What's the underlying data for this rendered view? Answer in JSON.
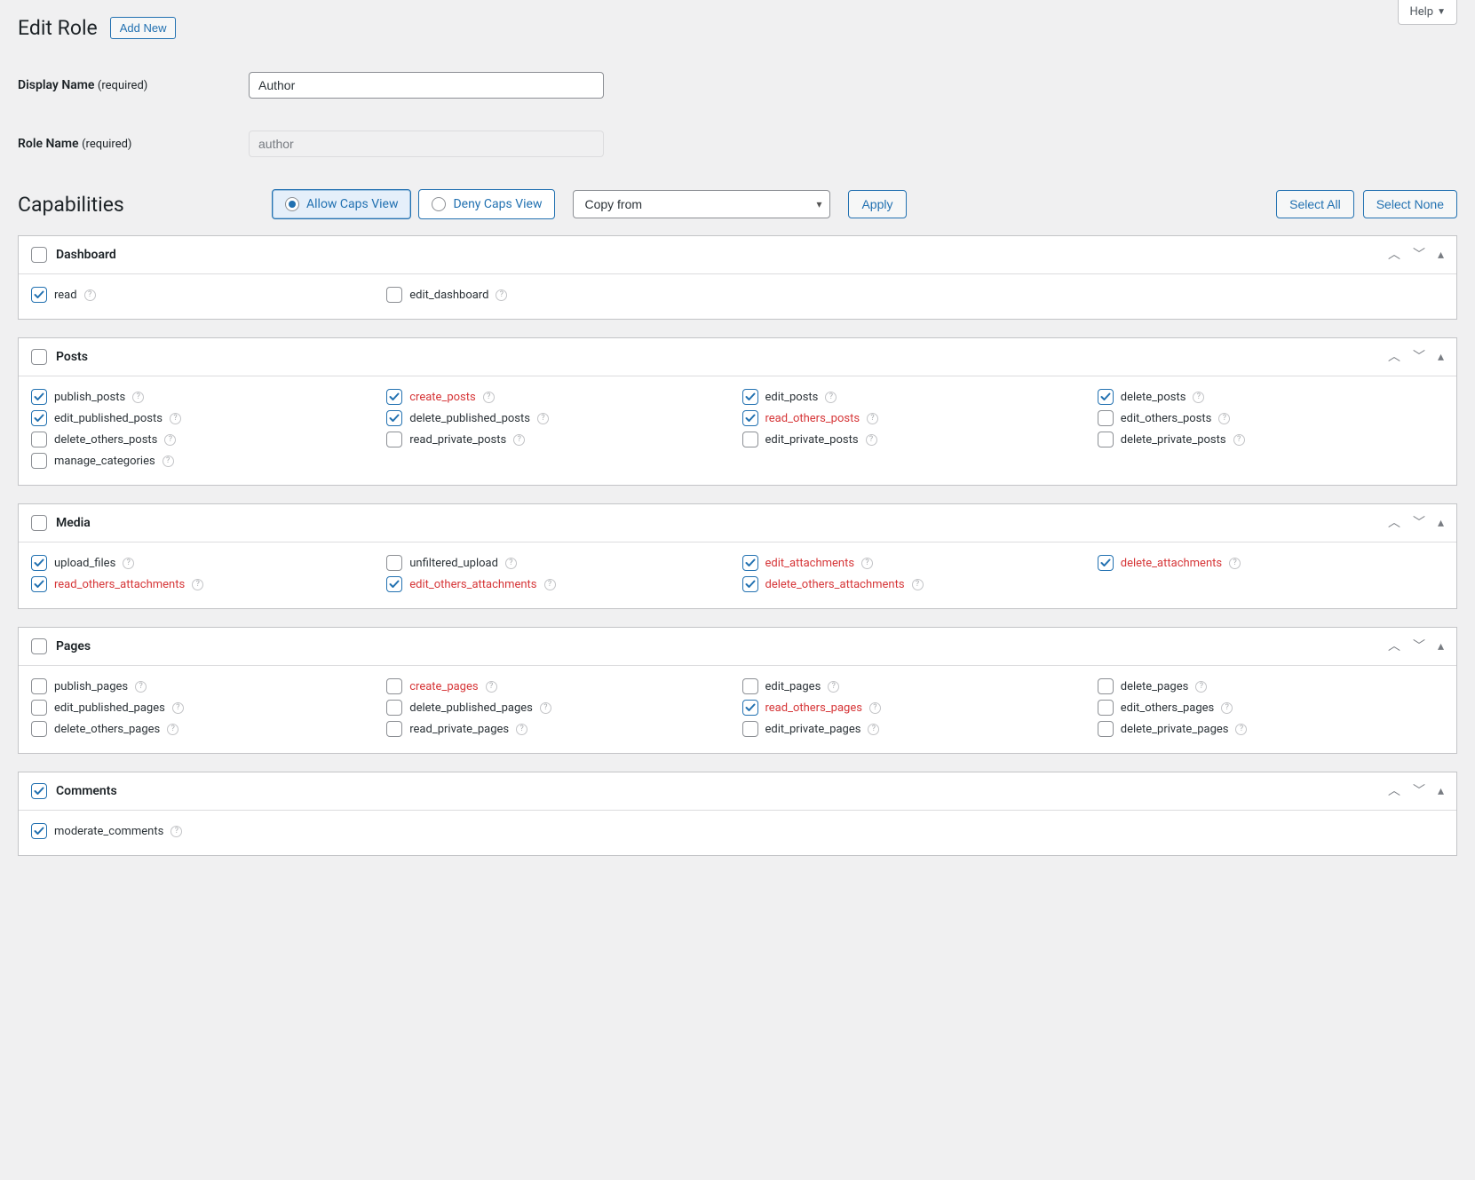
{
  "help_label": "Help",
  "page_title": "Edit Role",
  "add_new_label": "Add New",
  "display_name_label": "Display Name",
  "role_name_label": "Role Name",
  "required_label": "(required)",
  "display_name_value": "Author",
  "role_name_value": "author",
  "capabilities_title": "Capabilities",
  "allow_view_label": "Allow Caps View",
  "deny_view_label": "Deny Caps View",
  "copy_from_label": "Copy from",
  "apply_label": "Apply",
  "select_all_label": "Select All",
  "select_none_label": "Select None",
  "panels": [
    {
      "title": "Dashboard",
      "section_checked": false,
      "caps": [
        {
          "label": "read",
          "checked": true,
          "red": false
        },
        {
          "label": "edit_dashboard",
          "checked": false,
          "red": false
        }
      ]
    },
    {
      "title": "Posts",
      "section_checked": false,
      "caps": [
        {
          "label": "publish_posts",
          "checked": true,
          "red": false
        },
        {
          "label": "create_posts",
          "checked": true,
          "red": true
        },
        {
          "label": "edit_posts",
          "checked": true,
          "red": false
        },
        {
          "label": "delete_posts",
          "checked": true,
          "red": false
        },
        {
          "label": "edit_published_posts",
          "checked": true,
          "red": false
        },
        {
          "label": "delete_published_posts",
          "checked": true,
          "red": false
        },
        {
          "label": "read_others_posts",
          "checked": true,
          "red": true
        },
        {
          "label": "edit_others_posts",
          "checked": false,
          "red": false
        },
        {
          "label": "delete_others_posts",
          "checked": false,
          "red": false
        },
        {
          "label": "read_private_posts",
          "checked": false,
          "red": false
        },
        {
          "label": "edit_private_posts",
          "checked": false,
          "red": false
        },
        {
          "label": "delete_private_posts",
          "checked": false,
          "red": false
        },
        {
          "label": "manage_categories",
          "checked": false,
          "red": false
        }
      ]
    },
    {
      "title": "Media",
      "section_checked": false,
      "caps": [
        {
          "label": "upload_files",
          "checked": true,
          "red": false
        },
        {
          "label": "unfiltered_upload",
          "checked": false,
          "red": false
        },
        {
          "label": "edit_attachments",
          "checked": true,
          "red": true
        },
        {
          "label": "delete_attachments",
          "checked": true,
          "red": true
        },
        {
          "label": "read_others_attachments",
          "checked": true,
          "red": true
        },
        {
          "label": "edit_others_attachments",
          "checked": true,
          "red": true
        },
        {
          "label": "delete_others_attachments",
          "checked": true,
          "red": true
        }
      ]
    },
    {
      "title": "Pages",
      "section_checked": false,
      "caps": [
        {
          "label": "publish_pages",
          "checked": false,
          "red": false
        },
        {
          "label": "create_pages",
          "checked": false,
          "red": true
        },
        {
          "label": "edit_pages",
          "checked": false,
          "red": false
        },
        {
          "label": "delete_pages",
          "checked": false,
          "red": false
        },
        {
          "label": "edit_published_pages",
          "checked": false,
          "red": false
        },
        {
          "label": "delete_published_pages",
          "checked": false,
          "red": false
        },
        {
          "label": "read_others_pages",
          "checked": true,
          "red": true
        },
        {
          "label": "edit_others_pages",
          "checked": false,
          "red": false
        },
        {
          "label": "delete_others_pages",
          "checked": false,
          "red": false
        },
        {
          "label": "read_private_pages",
          "checked": false,
          "red": false
        },
        {
          "label": "edit_private_pages",
          "checked": false,
          "red": false
        },
        {
          "label": "delete_private_pages",
          "checked": false,
          "red": false
        }
      ]
    },
    {
      "title": "Comments",
      "section_checked": true,
      "caps": [
        {
          "label": "moderate_comments",
          "checked": true,
          "red": false
        }
      ]
    }
  ]
}
